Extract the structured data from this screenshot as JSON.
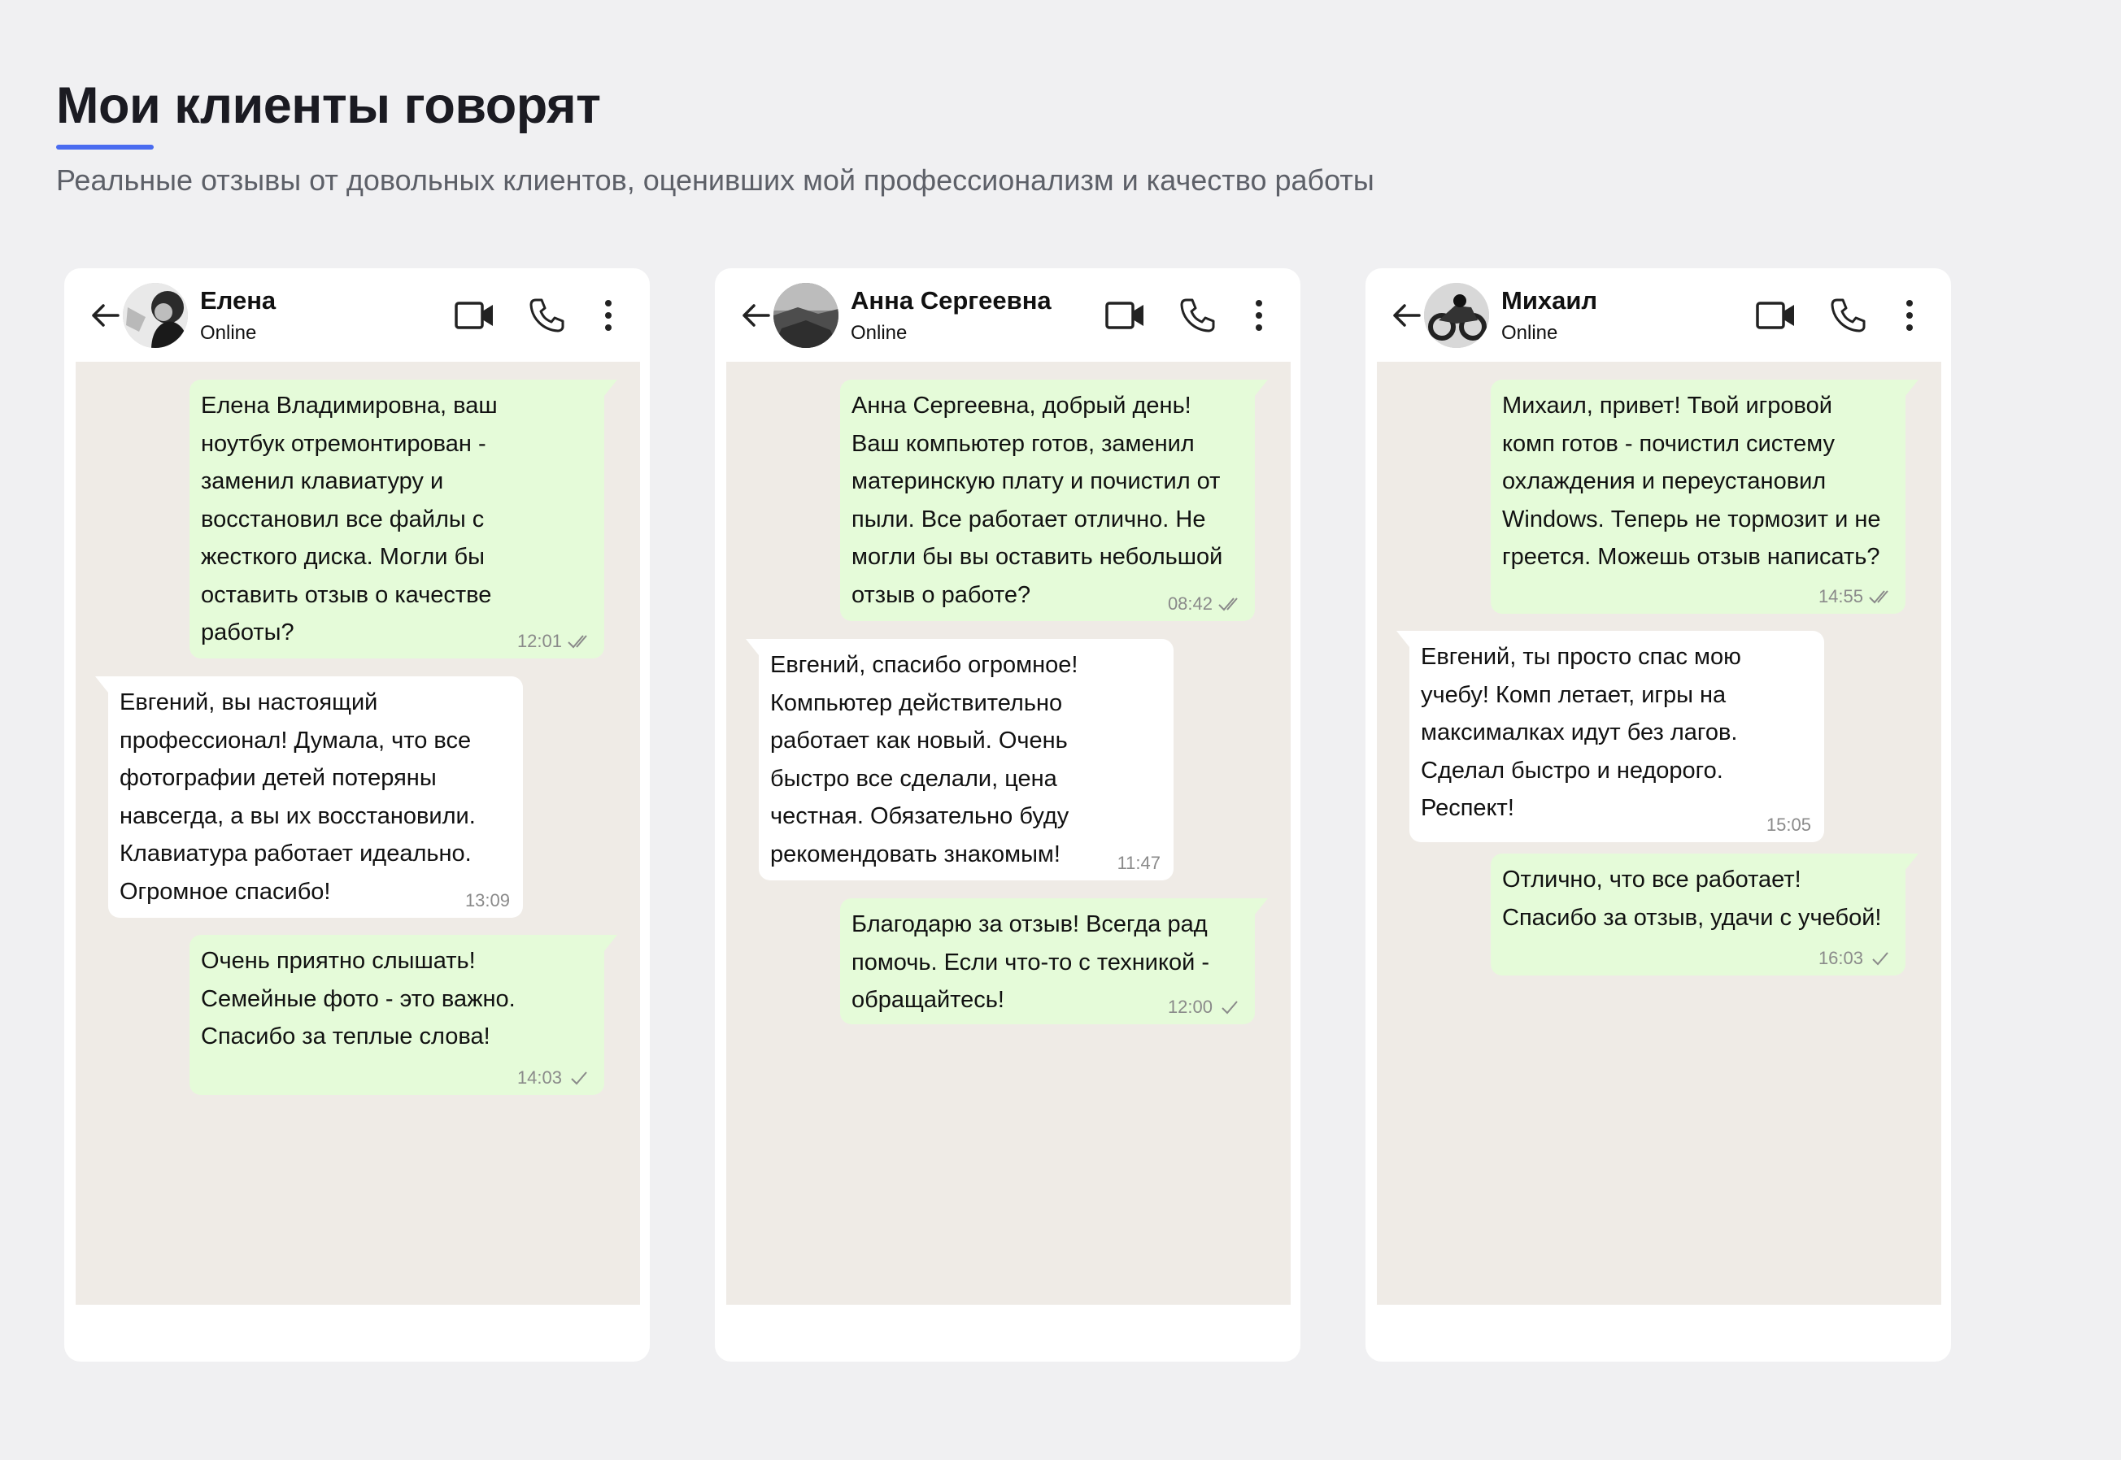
{
  "page": {
    "title": "Мои клиенты говорят",
    "subtitle": "Реальные отзывы от довольных клиентов, оценивших мой профессионализм и качество работы",
    "accent_color": "#4a6cf0",
    "background_color": "#f0f0f2"
  },
  "chats": [
    {
      "contact_name": "Елена",
      "status": "Online",
      "avatar_icon": "woman-portrait-avatar",
      "messages": [
        {
          "direction": "out",
          "text": "Елена Владимировна, ваш\nноутбук отремонтирован -\nзаменил клавиатуру и\nвосстановил все файлы с\nжесткого диска. Могли бы\nоставить отзыв о качестве\nработы?",
          "time": "12:01",
          "status_icon": "double-check-icon"
        },
        {
          "direction": "in",
          "text": "Евгений, вы настоящий\nпрофессионал! Думала, что все\nфотографии детей потеряны\nнавсегда, а вы их восстановили.\nКлавиатура работает идеально.\nОгромное спасибо!",
          "time": "13:09"
        },
        {
          "direction": "out",
          "text": "Очень приятно слышать!\nСемейные фото - это важно.\nСпасибо за теплые слова!",
          "time": "14:03",
          "status_icon": "single-check-icon"
        }
      ]
    },
    {
      "contact_name": "Анна Сергеевна",
      "status": "Online",
      "avatar_icon": "landscape-photo-avatar",
      "messages": [
        {
          "direction": "out",
          "text": "Анна Сергеевна, добрый день!\nВаш компьютер готов, заменил\nматеринскую плату и почистил от\nпыли. Все работает отлично. Не\nмогли бы вы оставить небольшой\nотзыв о работе?",
          "time": "08:42",
          "status_icon": "double-check-icon"
        },
        {
          "direction": "in",
          "text": "Евгений, спасибо огромное!\nКомпьютер действительно\nработает как новый. Очень\nбыстро все сделали, цена\nчестная. Обязательно буду\nрекомендовать знакомым!",
          "time": "11:47"
        },
        {
          "direction": "out",
          "text": "Благодарю за отзыв! Всегда рад\nпомочь. Если что-то с техникой -\nобращайтесь!",
          "time": "12:00",
          "status_icon": "single-check-icon"
        }
      ]
    },
    {
      "contact_name": "Михаил",
      "status": "Online",
      "avatar_icon": "motorcycle-avatar",
      "messages": [
        {
          "direction": "out",
          "text": "Михаил, привет! Твой игровой\nкомп готов - почистил систему\nохлаждения и переустановил\nWindows. Теперь не тормозит и не\nгреется. Можешь отзыв написать?",
          "time": "14:55",
          "status_icon": "double-check-icon"
        },
        {
          "direction": "in",
          "text": "Евгений, ты просто спас мою\nучебу! Комп летает, игры на\nмаксималках идут без лагов.\nСделал быстро и недорого.\nРеспект!",
          "time": "15:05"
        },
        {
          "direction": "out",
          "text": "Отлично, что все работает!\nСпасибо за отзыв, удачи с учебой!",
          "time": "16:03",
          "status_icon": "single-check-icon"
        }
      ]
    }
  ]
}
